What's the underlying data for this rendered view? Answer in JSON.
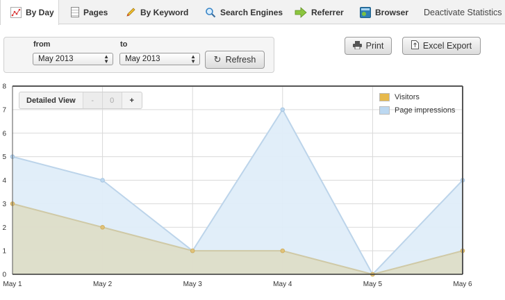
{
  "tabs": [
    {
      "label": "By Day",
      "icon": "line-chart-icon",
      "active": true
    },
    {
      "label": "Pages",
      "icon": "page-icon",
      "active": false
    },
    {
      "label": "By Keyword",
      "icon": "pencil-icon",
      "active": false
    },
    {
      "label": "Search Engines",
      "icon": "magnifier-icon",
      "active": false
    },
    {
      "label": "Referrer",
      "icon": "arrow-right-icon",
      "active": false
    },
    {
      "label": "Browser",
      "icon": "browser-icon",
      "active": false
    }
  ],
  "deactivate_label": "Deactivate Statistics",
  "filter": {
    "from_label": "from",
    "to_label": "to",
    "from_value": "May 2013",
    "to_value": "May 2013",
    "refresh_label": "Refresh"
  },
  "actions": {
    "print_label": "Print",
    "excel_label": "Excel Export"
  },
  "view_controls": {
    "label": "Detailed View",
    "minus": "-",
    "zero": "0",
    "plus": "+"
  },
  "colors": {
    "visitors_fill": "#ddddc8",
    "visitors_line": "#cfc9a6",
    "visitors_point": "#e0c27a",
    "visitors_legend": "#e7b94c",
    "impressions_fill": "#dfedf9",
    "impressions_line": "#bcd4ea",
    "impressions_legend": "#bcd8f1"
  },
  "chart_data": {
    "type": "area",
    "x": [
      "May 1",
      "May 2",
      "May 3",
      "May 4",
      "May 5",
      "May 6"
    ],
    "series": [
      {
        "name": "Visitors",
        "values": [
          3,
          2,
          1,
          1,
          0,
          1
        ]
      },
      {
        "name": "Page impressions",
        "values": [
          5,
          4,
          1,
          7,
          0,
          4
        ]
      }
    ],
    "ylim": [
      0,
      8
    ],
    "yticks": [
      "0",
      "1",
      "2",
      "3",
      "4",
      "5",
      "6",
      "7",
      "8"
    ],
    "grid": true,
    "legend_position": "top-right"
  }
}
